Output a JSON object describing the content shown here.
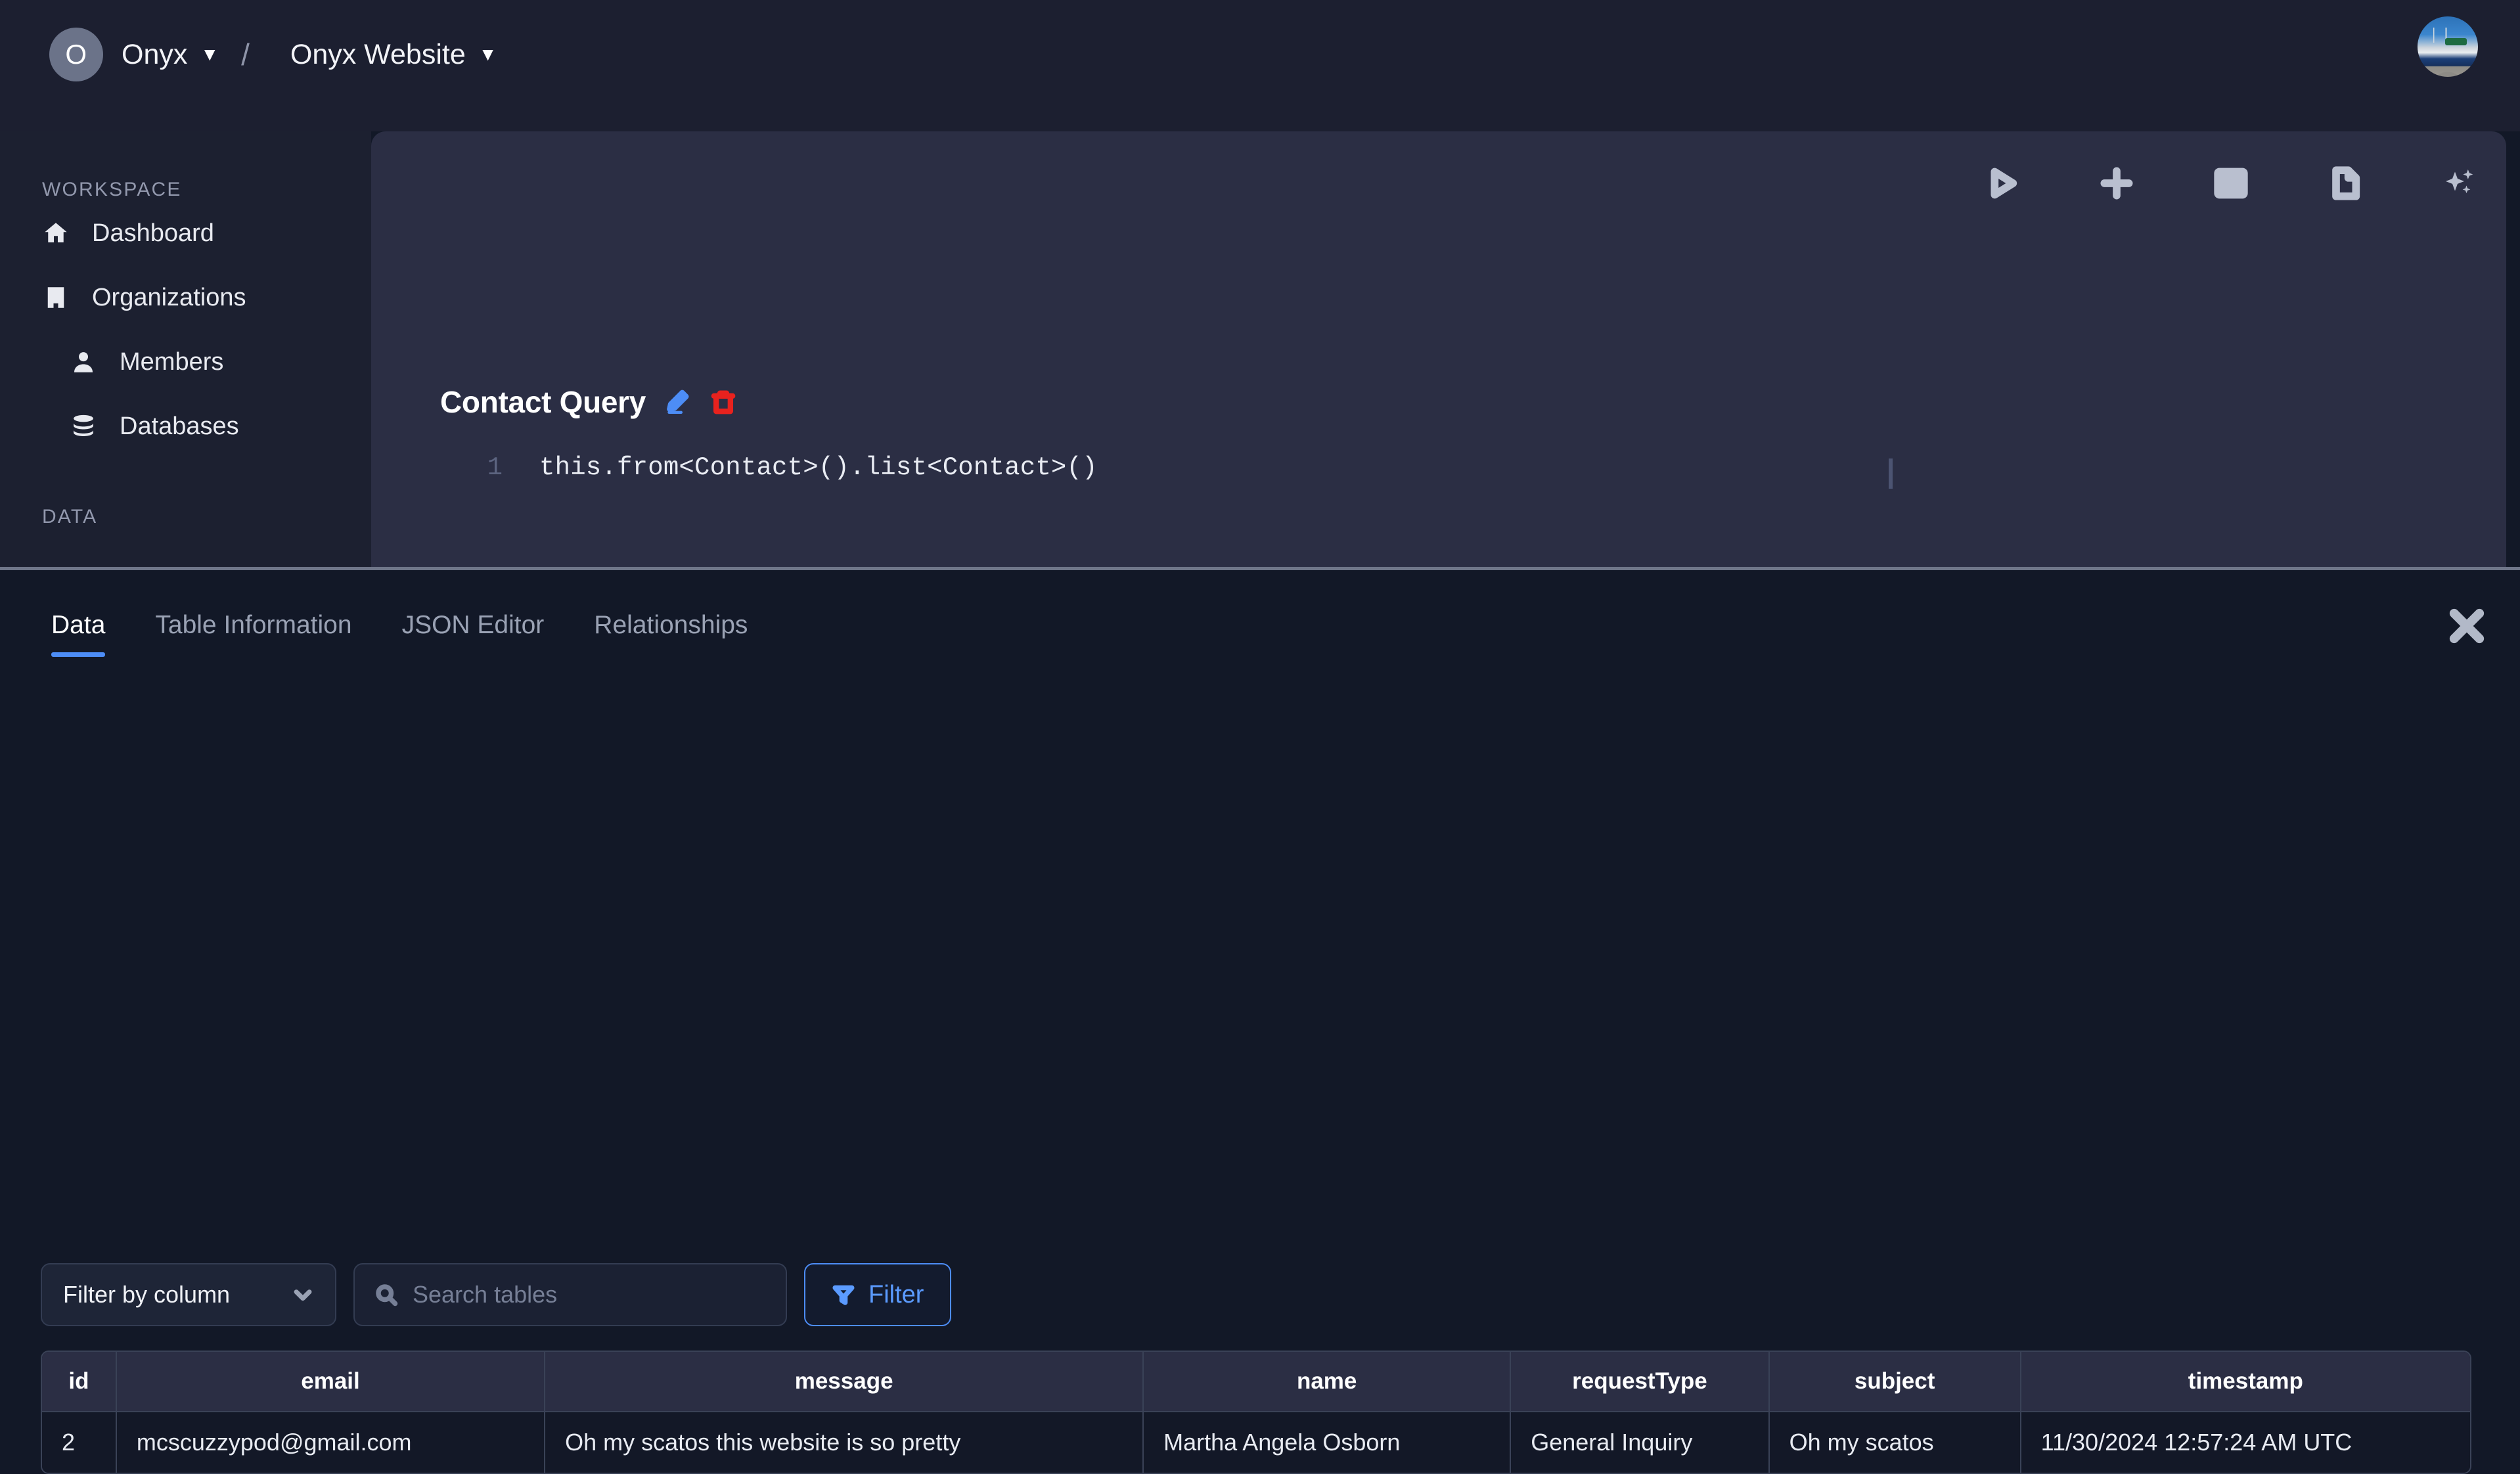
{
  "topbar": {
    "org_initial": "O",
    "org_name": "Onyx",
    "separator": "/",
    "project_name": "Onyx Website",
    "caret": "▼",
    "org_avatar_icon": "org-initial-avatar",
    "user_avatar_icon": "user-avatar-photo"
  },
  "sidebar": {
    "sections": [
      {
        "label": "WORKSPACE",
        "items": [
          {
            "label": "Dashboard",
            "icon": "home-icon",
            "indent": false
          },
          {
            "label": "Organizations",
            "icon": "building-icon",
            "indent": false
          },
          {
            "label": "Members",
            "icon": "person-icon",
            "indent": true
          },
          {
            "label": "Databases",
            "icon": "database-icon",
            "indent": true
          }
        ]
      },
      {
        "label": "DATA",
        "items": []
      }
    ]
  },
  "editor": {
    "title": "Contact Query",
    "edit_icon": "pencil-icon",
    "delete_icon": "trash-icon",
    "edit_icon_color": "#4d8df6",
    "delete_icon_color": "#e8221e",
    "toolbar": [
      {
        "name": "run-query-button",
        "icon": "play-icon"
      },
      {
        "name": "add-query-button",
        "icon": "plus-icon"
      },
      {
        "name": "table-view-button",
        "icon": "table-icon"
      },
      {
        "name": "document-view-button",
        "icon": "document-icon"
      },
      {
        "name": "ai-assist-button",
        "icon": "sparkles-icon"
      }
    ],
    "code_lines": [
      {
        "number": "1",
        "text": "this.from<Contact>().list<Contact>()"
      }
    ]
  },
  "bottom_panel": {
    "tabs": [
      {
        "label": "Data",
        "active": true
      },
      {
        "label": "Table Information",
        "active": false
      },
      {
        "label": "JSON Editor",
        "active": false
      },
      {
        "label": "Relationships",
        "active": false
      }
    ],
    "close_icon": "close-icon",
    "controls": {
      "column_filter_label": "Filter by column",
      "column_filter_icon": "chevron-down-icon",
      "search_placeholder": "Search tables",
      "search_value": "",
      "search_icon": "search-icon",
      "filter_button_label": "Filter",
      "filter_button_icon": "funnel-icon",
      "accent_color": "#4d8df6"
    },
    "table": {
      "columns": [
        "id",
        "email",
        "message",
        "name",
        "requestType",
        "subject",
        "timestamp"
      ],
      "rows": [
        {
          "id": "2",
          "email": "mcscuzzypod@gmail.com",
          "message": "Oh my scatos this website is so pretty",
          "name": "Martha Angela Osborn",
          "requestType": "General Inquiry",
          "subject": "Oh my scatos",
          "timestamp": "11/30/2024 12:57:24 AM UTC"
        }
      ]
    }
  }
}
